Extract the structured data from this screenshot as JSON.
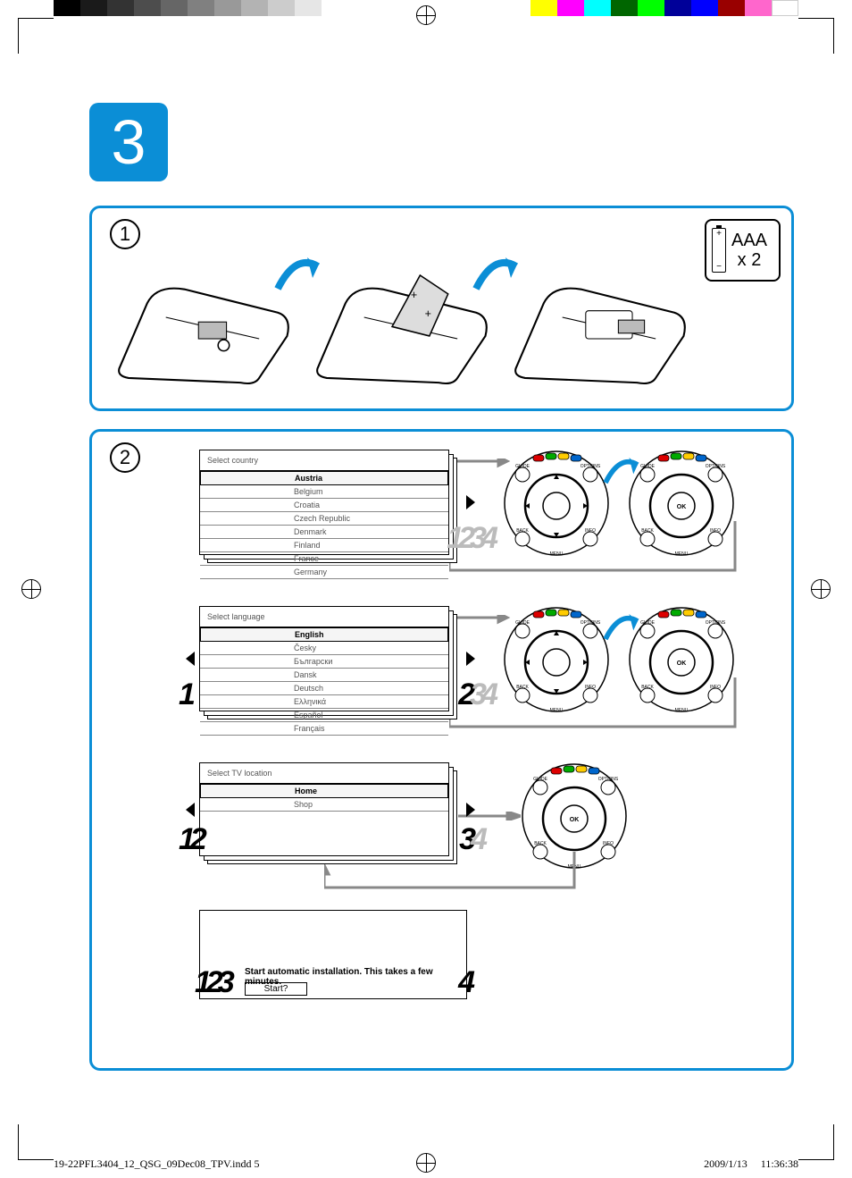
{
  "chapter": "3",
  "step1_label": "1",
  "step2_label": "2",
  "battery": {
    "type": "AAA",
    "qty": "x 2",
    "plus": "+",
    "minus": "−"
  },
  "country_menu": {
    "title": "Select country",
    "items": [
      "Austria",
      "Belgium",
      "Croatia",
      "Czech Republic",
      "Denmark",
      "Finland",
      "France",
      "Germany"
    ],
    "selected": "Austria",
    "ghost_nums": [
      "1",
      "2",
      "3",
      "4"
    ]
  },
  "language_menu": {
    "title": "Select language",
    "items": [
      "English",
      "Česky",
      "Български",
      "Dansk",
      "Deutsch",
      "Ελληνικά",
      "Español",
      "Français"
    ],
    "selected": "English",
    "ghost_left": "1",
    "ghost_right": [
      "2",
      "3",
      "4"
    ]
  },
  "location_menu": {
    "title": "Select TV location",
    "items": [
      "Home",
      "Shop"
    ],
    "selected": "Home",
    "ghost_left": [
      "1",
      "2"
    ],
    "ghost_right": [
      "3",
      "4"
    ]
  },
  "install": {
    "message": "Start automatic installation. This takes a few minutes.",
    "button": "Start?",
    "ghost_left": [
      "1",
      "2",
      "3"
    ],
    "ghost_right": "4"
  },
  "rc": {
    "guide": "GUIDE",
    "options": "OPTIONS",
    "back": "BACK",
    "info": "INFO",
    "ok": "OK",
    "menu": "MENU"
  },
  "footer": {
    "file": "19-22PFL3404_12_QSG_09Dec08_TPV.indd   5",
    "date": "2009/1/13",
    "time": "11:36:38"
  }
}
